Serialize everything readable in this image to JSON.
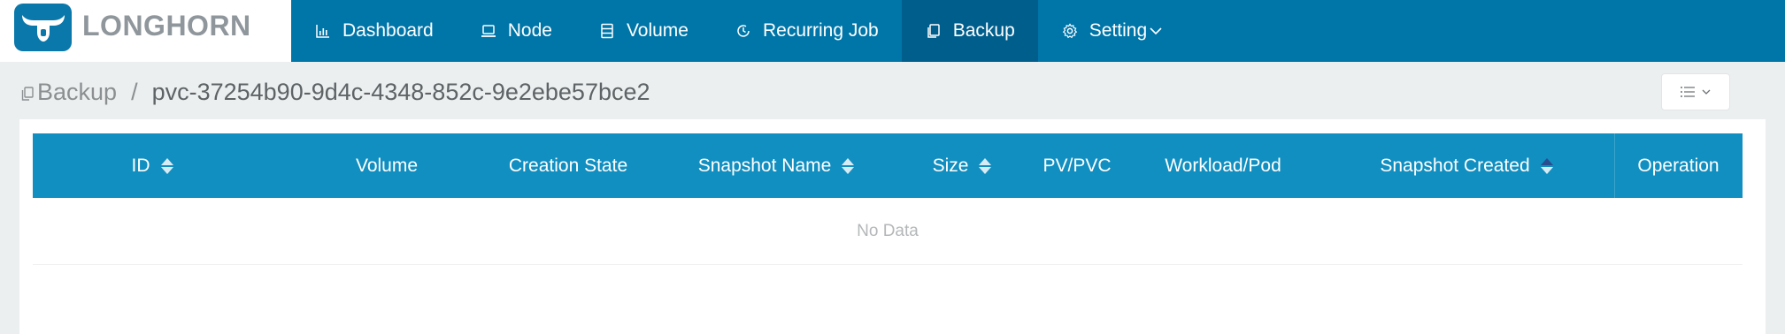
{
  "app": {
    "logo_text": "LONGHORN"
  },
  "nav": {
    "items": [
      {
        "label": "Dashboard",
        "icon": "bar-chart-icon"
      },
      {
        "label": "Node",
        "icon": "laptop-icon"
      },
      {
        "label": "Volume",
        "icon": "database-icon"
      },
      {
        "label": "Recurring Job",
        "icon": "clock-icon"
      },
      {
        "label": "Backup",
        "icon": "copy-icon",
        "active": true
      },
      {
        "label": "Setting",
        "icon": "gear-icon",
        "dropdown": true
      }
    ]
  },
  "breadcrumb": {
    "root": "Backup",
    "separator": "/",
    "current": "pvc-37254b90-9d4c-4348-852c-9e2ebe57bce2"
  },
  "table": {
    "columns": [
      {
        "label": "ID",
        "sortable": true
      },
      {
        "label": "Volume",
        "sortable": false
      },
      {
        "label": "Creation State",
        "sortable": false
      },
      {
        "label": "Snapshot Name",
        "sortable": true
      },
      {
        "label": "Size",
        "sortable": true
      },
      {
        "label": "PV/PVC",
        "sortable": false
      },
      {
        "label": "Workload/Pod",
        "sortable": false
      },
      {
        "label": "Snapshot Created",
        "sortable": true,
        "sorted": "ascending"
      },
      {
        "label": "Operation",
        "sortable": false
      }
    ],
    "rows": [],
    "empty_text": "No Data"
  },
  "colors": {
    "header": "#0075a8",
    "nav_active": "#005e8c",
    "table_header": "#118fc1",
    "page_bg": "#eceff0"
  }
}
